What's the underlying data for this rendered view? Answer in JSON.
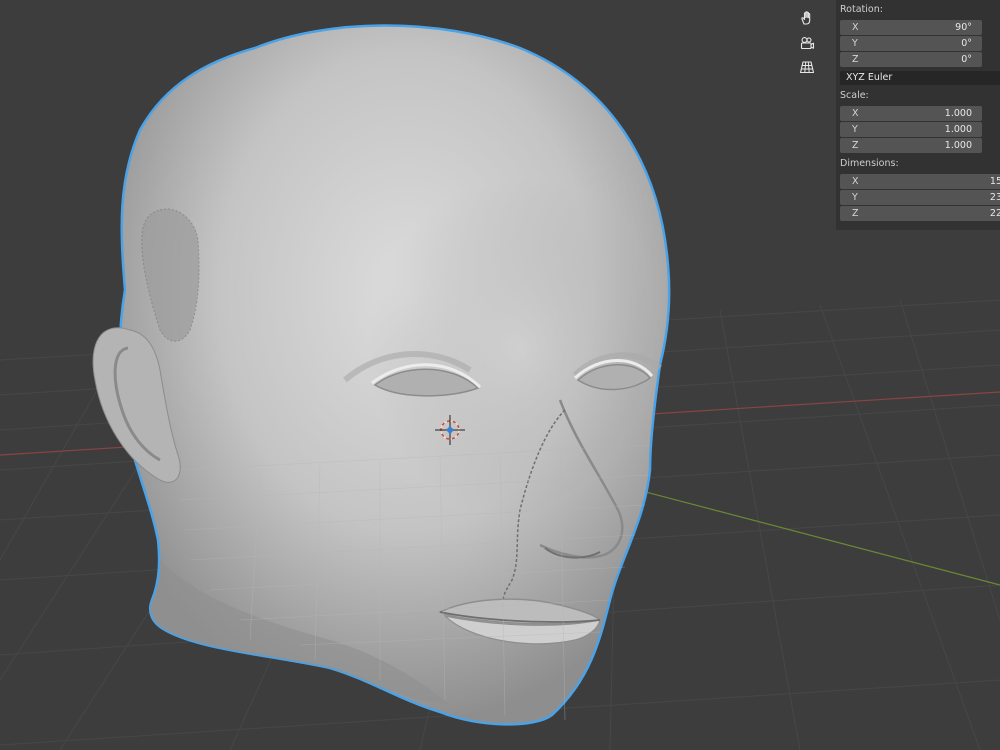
{
  "navigation": {
    "icons": [
      "hand-icon",
      "camera-icon",
      "grid-icon"
    ]
  },
  "properties": {
    "rotation": {
      "label": "Rotation:",
      "fields": [
        {
          "axis": "X",
          "value": "90°"
        },
        {
          "axis": "Y",
          "value": "0°"
        },
        {
          "axis": "Z",
          "value": "0°"
        }
      ],
      "mode": "XYZ Euler"
    },
    "scale": {
      "label": "Scale:",
      "fields": [
        {
          "axis": "X",
          "value": "1.000"
        },
        {
          "axis": "Y",
          "value": "1.000"
        },
        {
          "axis": "Z",
          "value": "1.000"
        }
      ]
    },
    "dimensions": {
      "label": "Dimensions:",
      "fields": [
        {
          "axis": "X",
          "value": "15"
        },
        {
          "axis": "Y",
          "value": "23"
        },
        {
          "axis": "Z",
          "value": "22"
        }
      ]
    }
  },
  "colors": {
    "background": "#3d3d3d",
    "selection_outline": "#4aa3e8",
    "x_axis": "#a04848",
    "y_axis": "#6e8c32",
    "panel": "#323232",
    "field": "#545454"
  }
}
